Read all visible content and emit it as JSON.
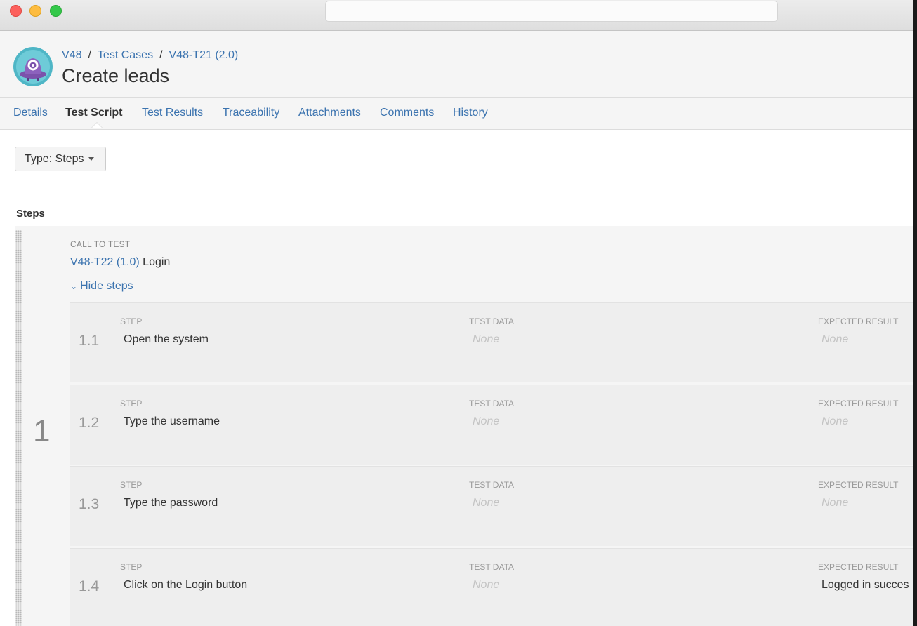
{
  "breadcrumb": {
    "project": "V48",
    "section": "Test Cases",
    "item": "V48-T21 (2.0)",
    "separator": "/"
  },
  "page_title": "Create leads",
  "tabs": [
    {
      "label": "Details"
    },
    {
      "label": "Test Script",
      "active": true
    },
    {
      "label": "Test Results"
    },
    {
      "label": "Traceability"
    },
    {
      "label": "Attachments"
    },
    {
      "label": "Comments"
    },
    {
      "label": "History"
    }
  ],
  "type_dropdown": {
    "label": "Type: Steps"
  },
  "steps_heading": "Steps",
  "step": {
    "number": "1",
    "call_label": "CALL TO TEST",
    "call_key": "V48-T22 (1.0)",
    "call_name": "Login",
    "toggle_label": "Hide steps",
    "column_labels": {
      "step": "STEP",
      "test_data": "TEST DATA",
      "expected": "EXPECTED RESULT"
    },
    "substeps": [
      {
        "num": "1.1",
        "text": "Open the system",
        "test_data": "None",
        "expected": "None",
        "expected_is_none": true
      },
      {
        "num": "1.2",
        "text": "Type the username",
        "test_data": "None",
        "expected": "None",
        "expected_is_none": true
      },
      {
        "num": "1.3",
        "text": "Type the password",
        "test_data": "None",
        "expected": "None",
        "expected_is_none": true
      },
      {
        "num": "1.4",
        "text": "Click on the Login button",
        "test_data": "None",
        "expected": "Logged in succes",
        "expected_is_none": false
      }
    ]
  },
  "colors": {
    "link": "#3b73af",
    "text": "#333333",
    "muted": "#999999",
    "panel": "#f5f5f5",
    "logo_teal": "#4fb6c6",
    "logo_purple": "#7b52ab"
  },
  "icons": {
    "logo": "test-management-app-logo-icon",
    "dropdown": "caret-down-icon",
    "toggle": "chevron-down-icon",
    "drag": "drag-handle-icon"
  }
}
